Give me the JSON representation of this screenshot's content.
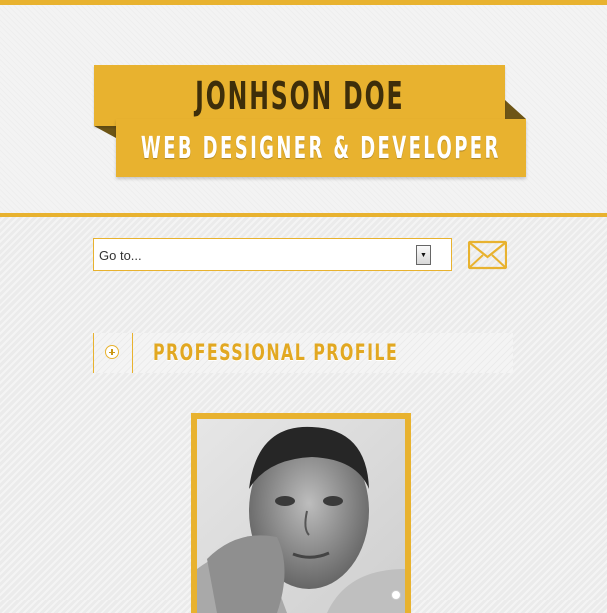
{
  "header": {
    "name": "JONHSON DOE",
    "role": "WEB DESIGNER & DEVELOPER"
  },
  "nav": {
    "select_value": "Go to...",
    "contact_icon": "envelope-icon"
  },
  "section": {
    "title": "PROFESSIONAL PROFILE",
    "toggle_icon": "plus-circle-icon"
  },
  "profile": {
    "photo": "profile-photo"
  },
  "colors": {
    "accent": "#e8b22f",
    "ribbon_shadow": "#6d5516",
    "name_text": "#3e2e0a"
  }
}
